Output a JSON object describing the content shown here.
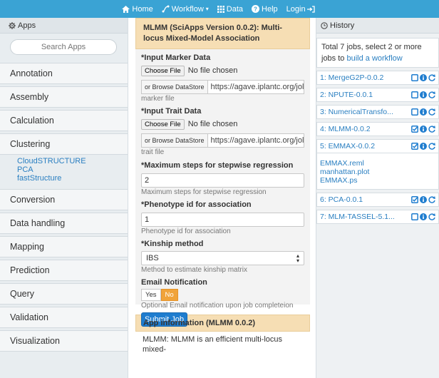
{
  "nav": {
    "home": "Home",
    "workflow": "Workflow",
    "data": "Data",
    "help": "Help",
    "login": "Login"
  },
  "sidebar": {
    "title": "Apps",
    "search_placeholder": "Search Apps",
    "categories": [
      "Annotation",
      "Assembly",
      "Calculation",
      "Clustering",
      "Conversion",
      "Data handling",
      "Mapping",
      "Prediction",
      "Query",
      "Validation",
      "Visualization"
    ],
    "clustering_apps": [
      "CloudSTRUCTURE",
      "PCA",
      "fastStructure"
    ]
  },
  "form": {
    "title": "MLMM (SciApps Version 0.0.2): Multi-locus Mixed-Model Association",
    "marker": {
      "label": "*Input Marker Data",
      "choose": "Choose File",
      "status": "No file chosen",
      "browse": "or Browse DataStore",
      "url": "https://agave.iplantc.org/jol",
      "help": "marker file"
    },
    "trait": {
      "label": "*Input Trait Data",
      "choose": "Choose File",
      "status": "No file chosen",
      "browse": "or Browse DataStore",
      "url": "https://agave.iplantc.org/jol",
      "help": "trait file"
    },
    "steps": {
      "label": "*Maximum steps for stepwise regression",
      "value": "2",
      "help": "Maximum steps for stepwise regression"
    },
    "phenotype": {
      "label": "*Phenotype id for association",
      "value": "1",
      "help": "Phenotype id for association"
    },
    "kinship": {
      "label": "*Kinship method",
      "value": "IBS",
      "help": "Method to estimate kinship matrix"
    },
    "email": {
      "label": "Email Notification",
      "yes": "Yes",
      "no": "No",
      "help": "Optional Email notification upon job completeion"
    },
    "submit": "Submit Job",
    "info_title": "App information (MLMM 0.0.2)",
    "info_text": "MLMM: MLMM is an efficient multi-locus mixed-"
  },
  "history": {
    "title": "History",
    "note_text": "Total 7 jobs, select 2 or more jobs to",
    "note_link": "build a workflow",
    "jobs": [
      "1: MergeG2P-0.0.2",
      "2: NPUTE-0.0.1",
      "3: NumericalTransfo...",
      "4: MLMM-0.0.2",
      "5: EMMAX-0.0.2",
      "6: PCA-0.0.1",
      "7: MLM-TASSEL-5.1..."
    ],
    "outputs": [
      "EMMAX.reml",
      "manhattan.plot",
      "EMMAX.ps"
    ]
  },
  "colors": {
    "nav_bg": "#3aa3d4",
    "panel_title_bg": "#f6deb4",
    "link": "#2a7fc1",
    "toggle_active": "#f0a33a",
    "submit_bg": "#1f7dcf"
  }
}
